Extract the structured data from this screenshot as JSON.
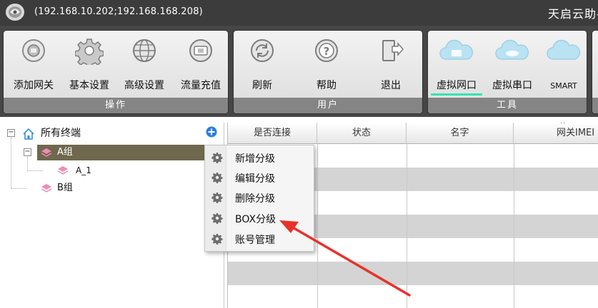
{
  "window": {
    "title_ip": "(192.168.10.202;192.168.168.208)",
    "title_app": "天启云助手"
  },
  "ribbon": {
    "groups": [
      {
        "name": "操作",
        "tools": [
          "添加网关",
          "基本设置",
          "高级设置",
          "流量充值"
        ]
      },
      {
        "name": "用户",
        "tools": [
          "刷新",
          "帮助",
          "退出"
        ]
      },
      {
        "name": "工具",
        "tools": [
          "虚拟网口",
          "虚拟串口",
          "SMART"
        ]
      }
    ],
    "icons": [
      "gateway-add-icon",
      "gear-icon",
      "globe-icon",
      "sim-card-icon",
      "refresh-icon",
      "help-icon",
      "exit-icon",
      "cloud-network-icon",
      "cloud-serial-icon",
      "cloud-smart-icon"
    ]
  },
  "tree": {
    "root": "所有终端",
    "nodes": [
      {
        "label": "A组",
        "children": [
          "A_1"
        ]
      },
      {
        "label": "B组",
        "children": []
      }
    ]
  },
  "grid": {
    "columns": [
      "是否连接",
      "状态",
      "名字",
      "网关IMEI"
    ]
  },
  "context_menu": {
    "items": [
      "新增分级",
      "编辑分级",
      "删除分级",
      "BOX分级",
      "账号管理"
    ]
  },
  "colors": {
    "accent": "#33e6b0",
    "selection": "#6f684e",
    "titlebar": "#3c3c3c",
    "arrow": "#e8312a"
  }
}
